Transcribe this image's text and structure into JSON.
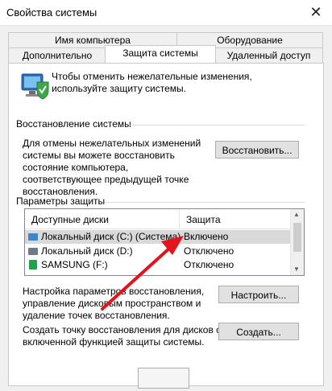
{
  "window": {
    "title": "Свойства системы",
    "close_glyph": "✕"
  },
  "tabs": {
    "row1": [
      "Имя компьютера",
      "Оборудование"
    ],
    "row2": [
      "Дополнительно",
      "Защита системы",
      "Удаленный доступ"
    ],
    "active": "Защита системы"
  },
  "intro": "Чтобы отменить нежелательные изменения, используйте защиту системы.",
  "restore": {
    "title": "Восстановление системы",
    "text": "Для отмены нежелательных изменений системы вы можете восстановить состояние компьютера, соответствующее предыдущей точке восстановления.",
    "button": "Восстановить..."
  },
  "protection": {
    "title": "Параметры защиты",
    "columns": [
      "Доступные диски",
      "Защита"
    ],
    "rows": [
      {
        "name": "Локальный диск (C:) (Система)",
        "status": "Включено",
        "icon": "system-drive-icon"
      },
      {
        "name": "Локальный диск (D:)",
        "status": "Отключено",
        "icon": "hard-drive-icon"
      },
      {
        "name": "SAMSUNG (F:)",
        "status": "Отключено",
        "icon": "usb-drive-icon"
      }
    ]
  },
  "configure": {
    "text": "Настройка параметров восстановления, управление дисковым пространством и удаление точек восстановления.",
    "button": "Настроить..."
  },
  "create": {
    "text": "Создать точку восстановления для дисков с включенной функцией защиты системы.",
    "button": "Создать..."
  },
  "colors": {
    "annotation_arrow": "#e3141b",
    "selection": "#d9d9d9"
  }
}
